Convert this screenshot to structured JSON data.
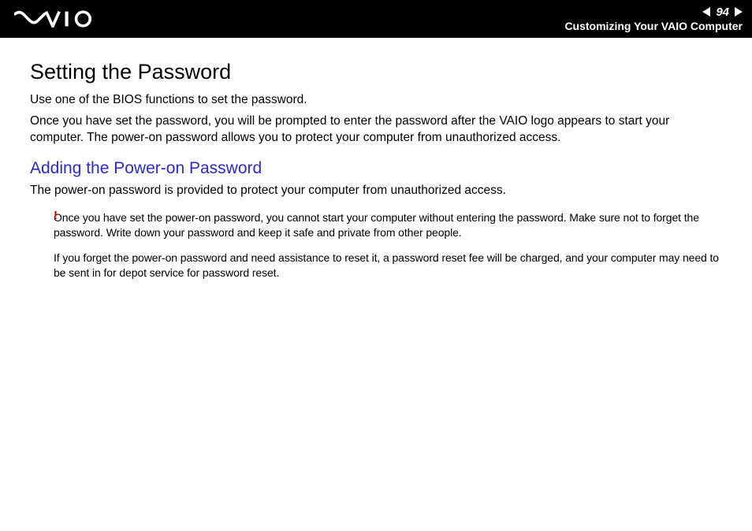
{
  "header": {
    "page_number": "94",
    "section_title": "Customizing Your VAIO Computer"
  },
  "content": {
    "title": "Setting the Password",
    "intro1": "Use one of the BIOS functions to set the password.",
    "intro2": "Once you have set the password, you will be prompted to enter the password after the VAIO logo appears to start your computer. The power-on password allows you to protect your computer from unauthorized access.",
    "subheading": "Adding the Power-on Password",
    "sub_intro": "The power-on password is provided to protect your computer from unauthorized access.",
    "warning_mark": "!",
    "note1": "Once you have set the power-on password, you cannot start your computer without entering the password. Make sure not to forget the password. Write down your password and keep it safe and private from other people.",
    "note2": "If you forget the power-on password and need assistance to reset it, a password reset fee will be charged, and your computer may need to be sent in for depot service for password reset."
  }
}
